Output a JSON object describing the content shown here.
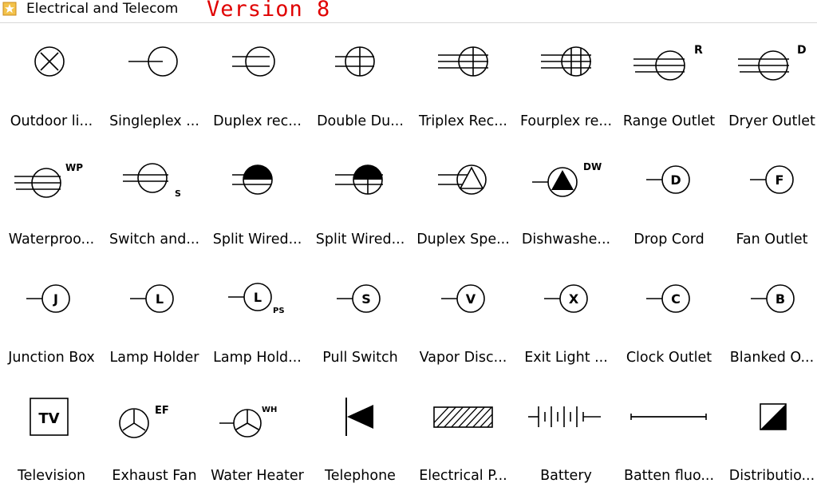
{
  "window": {
    "title": "Electrical and Telecom",
    "version": "Version 8"
  },
  "symbols": [
    {
      "label": "Outdoor li...",
      "icon": "outdoor-light-icon"
    },
    {
      "label": "Singleplex ...",
      "icon": "singleplex-receptacle-icon"
    },
    {
      "label": "Duplex rec...",
      "icon": "duplex-receptacle-icon"
    },
    {
      "label": "Double Du...",
      "icon": "double-duplex-receptacle-icon"
    },
    {
      "label": "Triplex Rec...",
      "icon": "triplex-receptacle-icon"
    },
    {
      "label": "Fourplex re...",
      "icon": "fourplex-receptacle-icon"
    },
    {
      "label": "Range Outlet",
      "icon": "range-outlet-icon",
      "tag": "R"
    },
    {
      "label": "Dryer Outlet",
      "icon": "dryer-outlet-icon",
      "tag": "D"
    },
    {
      "label": "Waterproo...",
      "icon": "waterproof-outlet-icon",
      "tag": "WP"
    },
    {
      "label": "Switch and...",
      "icon": "switch-and-outlet-icon",
      "tag": "S"
    },
    {
      "label": "Split Wired...",
      "icon": "split-wired-receptacle-icon"
    },
    {
      "label": "Split Wired...",
      "icon": "split-wired-double-receptacle-icon"
    },
    {
      "label": "Duplex Spe...",
      "icon": "duplex-special-purpose-icon"
    },
    {
      "label": "Dishwashe...",
      "icon": "dishwasher-outlet-icon",
      "tag": "DW"
    },
    {
      "label": "Drop Cord",
      "icon": "drop-cord-icon",
      "tag": "D"
    },
    {
      "label": "Fan Outlet",
      "icon": "fan-outlet-icon",
      "tag": "F"
    },
    {
      "label": "Junction Box",
      "icon": "junction-box-icon",
      "tag": "J"
    },
    {
      "label": "Lamp Holder",
      "icon": "lamp-holder-icon",
      "tag": "L"
    },
    {
      "label": "Lamp Hold...",
      "icon": "lamp-holder-pull-switch-icon",
      "tag": "L",
      "sub": "PS"
    },
    {
      "label": "Pull Switch",
      "icon": "pull-switch-icon",
      "tag": "S"
    },
    {
      "label": "Vapor Disc...",
      "icon": "vapor-discharge-icon",
      "tag": "V"
    },
    {
      "label": "Exit Light ...",
      "icon": "exit-light-icon",
      "tag": "X"
    },
    {
      "label": "Clock Outlet",
      "icon": "clock-outlet-icon",
      "tag": "C"
    },
    {
      "label": "Blanked O...",
      "icon": "blanked-outlet-icon",
      "tag": "B"
    },
    {
      "label": "Television",
      "icon": "television-icon",
      "tag": "TV"
    },
    {
      "label": "Exhaust Fan",
      "icon": "exhaust-fan-icon",
      "tag": "EF"
    },
    {
      "label": "Water Heater",
      "icon": "water-heater-icon",
      "tag": "WH"
    },
    {
      "label": "Telephone",
      "icon": "telephone-icon"
    },
    {
      "label": "Electrical P...",
      "icon": "electrical-panel-icon"
    },
    {
      "label": "Battery",
      "icon": "battery-icon"
    },
    {
      "label": "Batten fluo...",
      "icon": "batten-fluorescent-icon"
    },
    {
      "label": "Distributio...",
      "icon": "distribution-board-icon"
    }
  ]
}
